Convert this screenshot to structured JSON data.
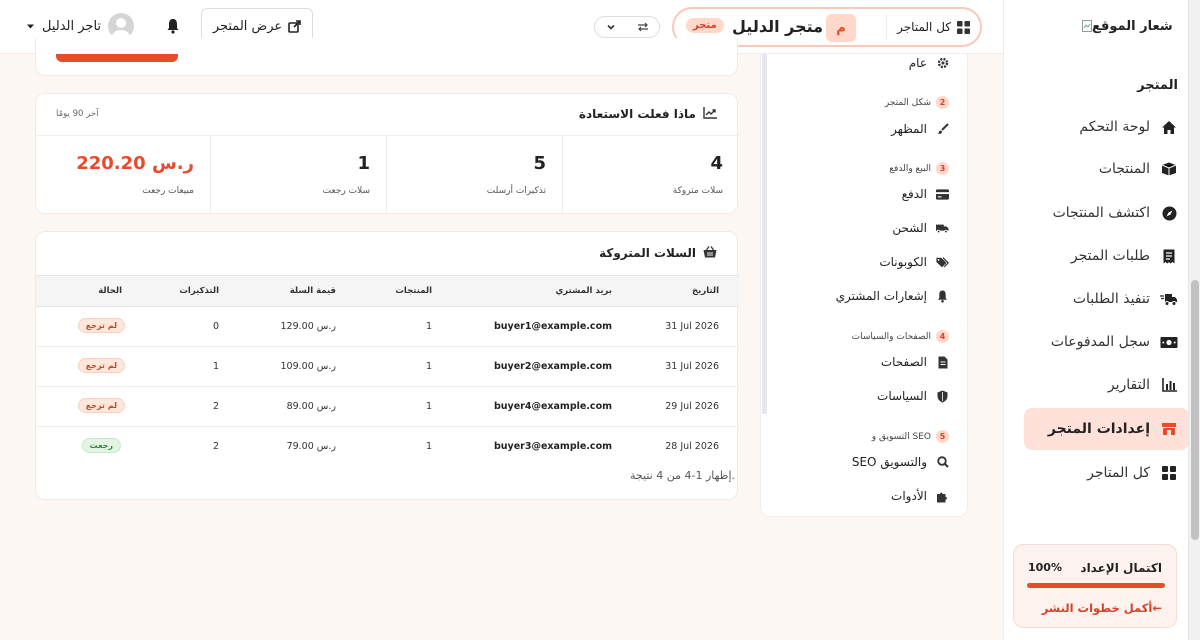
{
  "sidebar": {
    "logo_alt": "شعار الموقع",
    "section_title": "المتجر",
    "items": [
      {
        "label": "لوحة التحكم",
        "icon": "home-icon"
      },
      {
        "label": "المنتجات",
        "icon": "box-icon"
      },
      {
        "label": "اكتشف المنتجات",
        "icon": "compass-icon"
      },
      {
        "label": "طلبات المتجر",
        "icon": "receipt-icon"
      },
      {
        "label": "تنفيذ الطلبات",
        "icon": "truck-fast-icon"
      },
      {
        "label": "سجل المدفوعات",
        "icon": "money-icon"
      },
      {
        "label": "التقارير",
        "icon": "chart-bar-icon"
      },
      {
        "label": "إعدادات المتجر",
        "icon": "store-icon",
        "active": true
      },
      {
        "label": "كل المتاجر",
        "icon": "grid-icon"
      }
    ],
    "setup": {
      "label": "اكتمال الإعداد",
      "percent_text": "100%",
      "progress": 1.0,
      "link": "أكمل خطوات النشر←"
    }
  },
  "topbar": {
    "all_stores": "كل المتاجر",
    "store_initial": "م",
    "store_name": "متجر الدليل",
    "store_badge": "متجر",
    "view_store": "عرض المتجر",
    "user_name": "تاجر الدليل"
  },
  "settings_nav": {
    "general": "عام",
    "groups": [
      {
        "num": "2",
        "title": "شكل المتجر",
        "items": [
          "المظهر"
        ]
      },
      {
        "num": "3",
        "title": "البيع والدفع",
        "items": [
          "الدفع",
          "الشحن",
          "الكوبونات",
          "إشعارات المشتري"
        ]
      },
      {
        "num": "4",
        "title": "الصفحات والسياسات",
        "items": [
          "الصفحات",
          "السياسات"
        ]
      },
      {
        "num": "5",
        "title": "التسويق و SEO",
        "items": [
          "SEO والتسويق",
          "الأدوات"
        ]
      }
    ]
  },
  "recovery": {
    "title": "ماذا فعلت الاستعادة",
    "range": "آخر 90 يومًا",
    "stats": [
      {
        "value": "4",
        "label": "سلات متروكة"
      },
      {
        "value": "5",
        "label": "تذكيرات أرسلت"
      },
      {
        "value": "1",
        "label": "سلات رجعت"
      },
      {
        "value": "220.20 ر.س",
        "label": "مبيعات رجعت"
      }
    ]
  },
  "carts": {
    "title": "السلات المتروكة",
    "columns": [
      "التاريخ",
      "بريد المشتري",
      "المنتجات",
      "قيمة السلة",
      "التذكيرات",
      "الحالة"
    ],
    "rows": [
      {
        "date": "31 Jul 2026",
        "email": "buyer1@example.com",
        "products": "1",
        "value": "129.00 ر.س",
        "reminders": "0",
        "status": "لم ترجع",
        "returned": false
      },
      {
        "date": "31 Jul 2026",
        "email": "buyer2@example.com",
        "products": "1",
        "value": "109.00 ر.س",
        "reminders": "1",
        "status": "لم ترجع",
        "returned": false
      },
      {
        "date": "29 Jul 2026",
        "email": "buyer4@example.com",
        "products": "1",
        "value": "89.00 ر.س",
        "reminders": "2",
        "status": "لم ترجع",
        "returned": false
      },
      {
        "date": "28 Jul 2026",
        "email": "buyer3@example.com",
        "products": "1",
        "value": "79.00 ر.س",
        "reminders": "2",
        "status": "رجعت",
        "returned": true
      }
    ],
    "pager": "إظهار 1-4 من 4 نتيجة."
  }
}
